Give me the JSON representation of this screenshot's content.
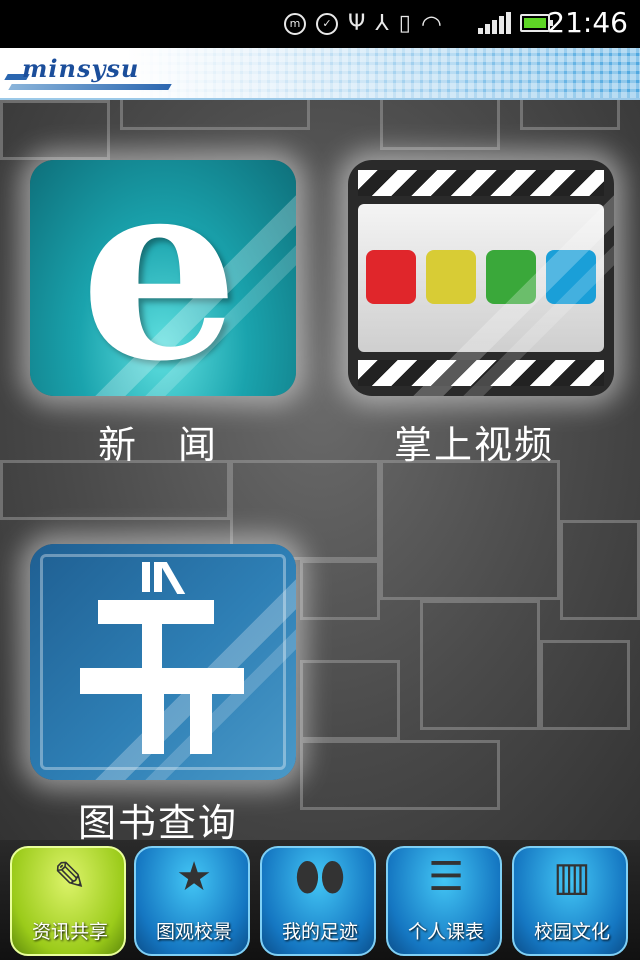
{
  "status_bar": {
    "time": "21:46",
    "icons": [
      "m-notification-icon",
      "check-circle-icon",
      "usb-icon",
      "share-icon",
      "vibrate-icon",
      "wifi-icon",
      "signal-icon",
      "battery-icon"
    ],
    "battery_color": "#5ed625"
  },
  "header": {
    "logo_text": "minsysu"
  },
  "apps": [
    {
      "label": "新　闻",
      "icon": "news-e-icon",
      "glyph": "e"
    },
    {
      "label": "掌上视频",
      "icon": "video-clapper-icon"
    },
    {
      "label": "图书查询",
      "icon": "book-stack-icon"
    }
  ],
  "bottom_nav": [
    {
      "label": "资讯共享",
      "icon": "scroll-icon",
      "active": true
    },
    {
      "label": "图观校景",
      "icon": "film-star-icon",
      "active": false
    },
    {
      "label": "我的足迹",
      "icon": "footprints-icon",
      "active": false
    },
    {
      "label": "个人课表",
      "icon": "calendar-icon",
      "active": false
    },
    {
      "label": "校园文化",
      "icon": "gate-icon",
      "active": false
    }
  ],
  "colors": {
    "video_squares": [
      "#e0262b",
      "#d8cc35",
      "#3aa83a",
      "#1a9fd8"
    ],
    "nav_active": "#9bcb1a",
    "nav_default": "#1577c2"
  }
}
